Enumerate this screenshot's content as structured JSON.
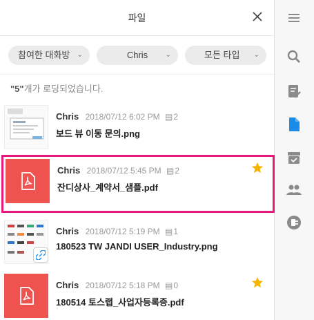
{
  "header": {
    "title": "파일"
  },
  "filters": {
    "room": "참여한 대화방",
    "member": "Chris",
    "type": "모든 타입"
  },
  "count": {
    "number": "\"5\"",
    "suffix": "개가 로딩되었습니다."
  },
  "files": [
    {
      "author": "Chris",
      "date": "2018/07/12 6:02 PM",
      "comments": "2",
      "name": "보드 뷰 이동 문의.png",
      "kind": "image",
      "starred": false
    },
    {
      "author": "Chris",
      "date": "2018/07/12 5:45 PM",
      "comments": "2",
      "name": "잔디상사_계약서_샘플.pdf",
      "kind": "pdf",
      "starred": true
    },
    {
      "author": "Chris",
      "date": "2018/07/12 5:19 PM",
      "comments": "1",
      "name": "180523 TW JANDI USER_Industry.png",
      "kind": "image",
      "starred": false
    },
    {
      "author": "Chris",
      "date": "2018/07/12 5:18 PM",
      "comments": "0",
      "name": "180514 토스랩_사업자등록증.pdf",
      "kind": "pdf",
      "starred": true
    }
  ],
  "colors": {
    "accent": "#1a8ce8",
    "pdf": "#ef5350",
    "star": "#f5b400",
    "highlight": "#e5197e"
  }
}
